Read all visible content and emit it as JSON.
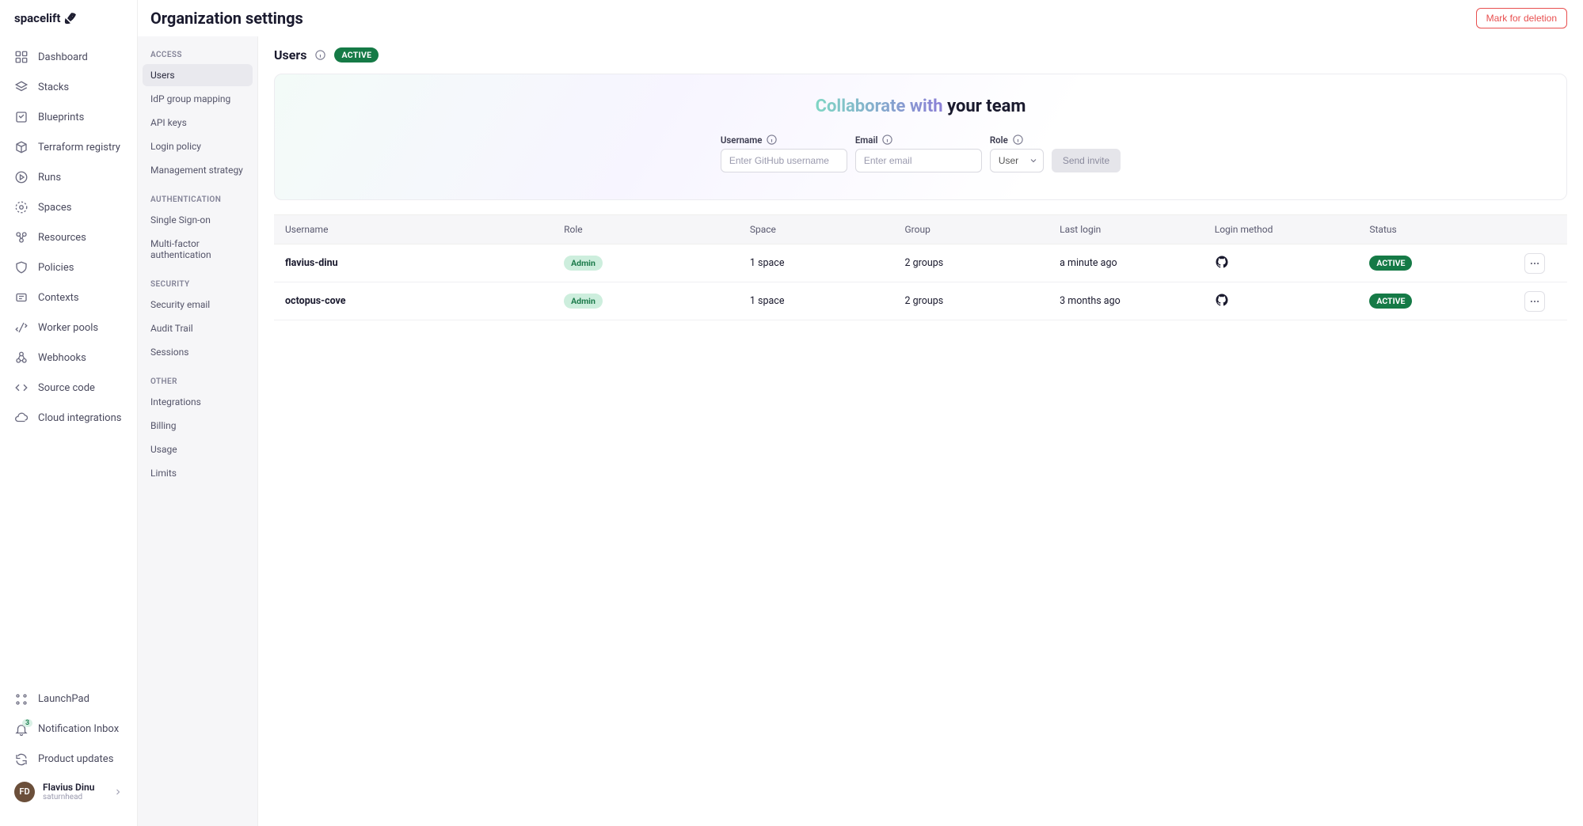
{
  "brand": "spacelift",
  "page": {
    "title": "Organization settings",
    "mark_delete": "Mark for deletion"
  },
  "nav": {
    "main": [
      {
        "label": "Dashboard"
      },
      {
        "label": "Stacks"
      },
      {
        "label": "Blueprints"
      },
      {
        "label": "Terraform registry"
      },
      {
        "label": "Runs"
      },
      {
        "label": "Spaces"
      },
      {
        "label": "Resources"
      },
      {
        "label": "Policies"
      },
      {
        "label": "Contexts"
      },
      {
        "label": "Worker pools"
      },
      {
        "label": "Webhooks"
      },
      {
        "label": "Source code"
      },
      {
        "label": "Cloud integrations"
      }
    ],
    "bottom": [
      {
        "label": "LaunchPad"
      },
      {
        "label": "Notification Inbox",
        "badge": "3"
      },
      {
        "label": "Product updates"
      }
    ]
  },
  "user": {
    "name": "Flavius Dinu",
    "sub": "saturnhead"
  },
  "settings_nav": {
    "sections": [
      {
        "title": "ACCESS",
        "items": [
          "Users",
          "IdP group mapping",
          "API keys",
          "Login policy",
          "Management strategy"
        ],
        "active": 0
      },
      {
        "title": "AUTHENTICATION",
        "items": [
          "Single Sign-on",
          "Multi-factor authentication"
        ]
      },
      {
        "title": "SECURITY",
        "items": [
          "Security email",
          "Audit Trail",
          "Sessions"
        ]
      },
      {
        "title": "OTHER",
        "items": [
          "Integrations",
          "Billing",
          "Usage",
          "Limits"
        ]
      }
    ]
  },
  "users_section": {
    "title": "Users",
    "status": "ACTIVE",
    "collab": {
      "title_grad": "Collaborate with",
      "title_rest": " your team",
      "username_label": "Username",
      "username_placeholder": "Enter GitHub username",
      "email_label": "Email",
      "email_placeholder": "Enter email",
      "role_label": "Role",
      "role_value": "User",
      "send_label": "Send invite"
    },
    "columns": [
      "Username",
      "Role",
      "Space",
      "Group",
      "Last login",
      "Login method",
      "Status"
    ],
    "rows": [
      {
        "username": "flavius-dinu",
        "role": "Admin",
        "space": "1 space",
        "group": "2 groups",
        "last_login": "a minute ago",
        "status": "ACTIVE"
      },
      {
        "username": "octopus-cove",
        "role": "Admin",
        "space": "1 space",
        "group": "2 groups",
        "last_login": "3 months ago",
        "status": "ACTIVE"
      }
    ]
  }
}
